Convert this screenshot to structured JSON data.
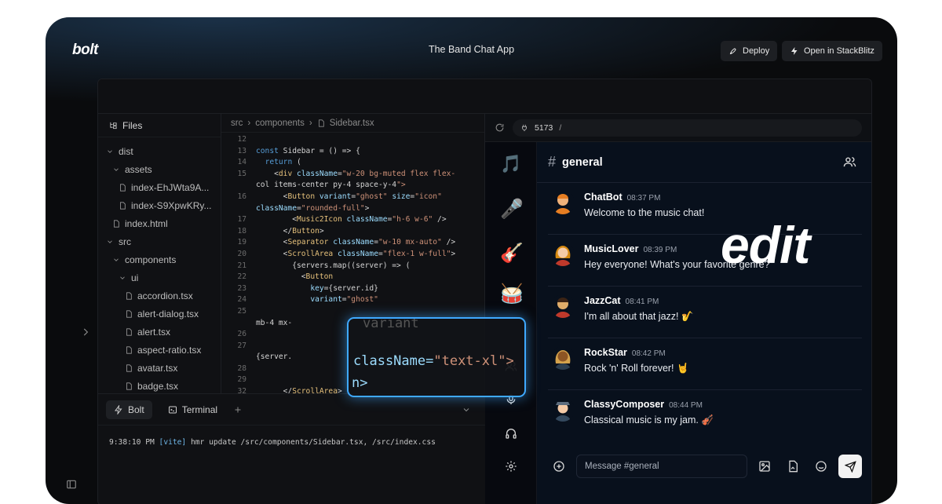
{
  "topbar": {
    "logo": "bolt",
    "title": "The Band Chat App",
    "deploy_label": "Deploy",
    "open_label": "Open in StackBlitz"
  },
  "files": {
    "header": "Files",
    "tree": [
      {
        "label": "dist",
        "type": "folder",
        "depth": 0
      },
      {
        "label": "assets",
        "type": "folder",
        "depth": 1
      },
      {
        "label": "index-EhJWta9A...",
        "type": "file",
        "depth": 2
      },
      {
        "label": "index-S9XpwKRy...",
        "type": "file",
        "depth": 2
      },
      {
        "label": "index.html",
        "type": "file",
        "depth": 1
      },
      {
        "label": "src",
        "type": "folder",
        "depth": 0
      },
      {
        "label": "components",
        "type": "folder",
        "depth": 1
      },
      {
        "label": "ui",
        "type": "folder",
        "depth": 2
      },
      {
        "label": "accordion.tsx",
        "type": "file",
        "depth": 3
      },
      {
        "label": "alert-dialog.tsx",
        "type": "file",
        "depth": 3
      },
      {
        "label": "alert.tsx",
        "type": "file",
        "depth": 3
      },
      {
        "label": "aspect-ratio.tsx",
        "type": "file",
        "depth": 3
      },
      {
        "label": "avatar.tsx",
        "type": "file",
        "depth": 3
      },
      {
        "label": "badge.tsx",
        "type": "file",
        "depth": 3
      },
      {
        "label": "breadcrumb.tsx",
        "type": "file",
        "depth": 3
      }
    ]
  },
  "editor": {
    "breadcrumb": [
      "src",
      "components",
      "Sidebar.tsx"
    ],
    "lines": [
      {
        "n": "12",
        "t": ""
      },
      {
        "n": "13",
        "t": "const Sidebar = () => {"
      },
      {
        "n": "14",
        "t": "  return ("
      },
      {
        "n": "15",
        "t": "    <div className=\"w-20 bg-muted flex flex-"
      },
      {
        "n": "",
        "t": "col items-center py-4 space-y-4\">"
      },
      {
        "n": "16",
        "t": "      <Button variant=\"ghost\" size=\"icon\""
      },
      {
        "n": "",
        "t": "className=\"rounded-full\">"
      },
      {
        "n": "17",
        "t": "        <Music2Icon className=\"h-6 w-6\" />"
      },
      {
        "n": "18",
        "t": "      </Button>"
      },
      {
        "n": "19",
        "t": "      <Separator className=\"w-10 mx-auto\" />"
      },
      {
        "n": "20",
        "t": "      <ScrollArea className=\"flex-1 w-full\">"
      },
      {
        "n": "21",
        "t": "        {servers.map((server) => ("
      },
      {
        "n": "22",
        "t": "          <Button"
      },
      {
        "n": "23",
        "t": "            key={server.id}"
      },
      {
        "n": "24",
        "t": "            variant=\"ghost\""
      },
      {
        "n": "25",
        "t": ""
      },
      {
        "n": "",
        "t": "mb-4 mx-"
      },
      {
        "n": "26",
        "t": ""
      },
      {
        "n": "27",
        "t": ""
      },
      {
        "n": "",
        "t": "{server."
      },
      {
        "n": "28",
        "t": ""
      },
      {
        "n": "29",
        "t": ""
      },
      {
        "n": "32",
        "t": "      </ScrollArea>"
      }
    ],
    "zoom_top": "variant",
    "zoom_line_attr": "className=",
    "zoom_line_str": "\"text-xl\">",
    "zoom_bottom": "n>"
  },
  "bottom": {
    "tab_bolt": "Bolt",
    "tab_terminal": "Terminal",
    "term_time": "9:38:10 PM",
    "term_vite": "[vite]",
    "term_msg": " hmr update /src/components/Sidebar.tsx, /src/index.css"
  },
  "preview": {
    "port": "5173",
    "path": "/"
  },
  "chat": {
    "channel": "general",
    "messages": [
      {
        "user": "ChatBot",
        "time": "08:37 PM",
        "text": "Welcome to the music chat!"
      },
      {
        "user": "MusicLover",
        "time": "08:39 PM",
        "text": "Hey everyone! What's your favorite genre?"
      },
      {
        "user": "JazzCat",
        "time": "08:41 PM",
        "text": "I'm all about that jazz! 🎷"
      },
      {
        "user": "RockStar",
        "time": "08:42 PM",
        "text": "Rock 'n' Roll forever! 🤘"
      },
      {
        "user": "ClassyComposer",
        "time": "08:44 PM",
        "text": "Classical music is my jam. 🎻"
      }
    ],
    "input_placeholder": "Message #general",
    "servers": [
      "🎵",
      "🎤",
      "🎸",
      "🥁"
    ]
  },
  "overlay_text": "edit"
}
